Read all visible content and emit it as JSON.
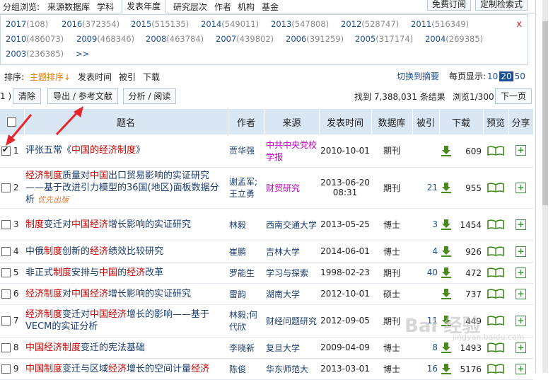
{
  "groupbar": {
    "label": "分组浏览:",
    "items": [
      "来源数据库",
      "学科",
      "发表年度",
      "研究层次",
      "作者",
      "机构",
      "基金"
    ],
    "buttons": [
      "免费订阅",
      "定制检索式"
    ]
  },
  "years": {
    "close": "x",
    "more": ">>",
    "items": [
      {
        "year": "2017",
        "count": "(108)"
      },
      {
        "year": "2016",
        "count": "(372354)"
      },
      {
        "year": "2015",
        "count": "(515135)"
      },
      {
        "year": "2014",
        "count": "(549011)"
      },
      {
        "year": "2013",
        "count": "(547808)"
      },
      {
        "year": "2012",
        "count": "(528747)"
      },
      {
        "year": "2011",
        "count": "(516349)"
      },
      {
        "year": "2010",
        "count": "(486073)"
      },
      {
        "year": "2009",
        "count": "(468346)"
      },
      {
        "year": "2008",
        "count": "(463784)"
      },
      {
        "year": "2007",
        "count": "(439802)"
      },
      {
        "year": "2006",
        "count": "(391259)"
      },
      {
        "year": "2005",
        "count": "(317174)"
      },
      {
        "year": "2004",
        "count": "(269385)"
      },
      {
        "year": "2003",
        "count": "(236385)"
      }
    ]
  },
  "sortbar": {
    "label": "排序:",
    "options": [
      "主题排序",
      "发表时间",
      "被引",
      "下载"
    ],
    "active_arrow": "↓",
    "switch_label": "切换到摘要",
    "page_size_label": "每页显示:",
    "page_sizes": [
      "10",
      "20",
      "50"
    ],
    "selected_page_size": "20"
  },
  "actions": {
    "count_prefix": "1 )",
    "clear": "清除",
    "export": "导出 / 参考文献",
    "analyze": "分析 / 阅读",
    "found": "找到 7,388,031 条结果",
    "browse": "浏览1/300",
    "next": "下一页"
  },
  "table": {
    "headers": [
      "题名",
      "作者",
      "来源",
      "发表时间",
      "数据库",
      "被引",
      "下载",
      "预览",
      "分享"
    ],
    "rows": [
      {
        "n": "1",
        "checked": true,
        "title": [
          [
            "评张五常《",
            0
          ],
          [
            "中国的经济制度",
            1
          ],
          [
            "》",
            0
          ]
        ],
        "sub": "",
        "author": "贾华强",
        "source": "中共中央党校学报",
        "source_mag": true,
        "date": "2010-10-01",
        "db": "期刊",
        "cite": "",
        "dl": "609"
      },
      {
        "n": "2",
        "checked": false,
        "title": [
          [
            "经济制度",
            1
          ],
          [
            "质量对",
            0
          ],
          [
            "中国",
            1
          ],
          [
            "出口贸易影响的实证研究——基于改进引力模型的36国(地区)面板数据分析",
            0
          ]
        ],
        "sub": "优先出版",
        "author": "谢孟军;王立勇",
        "source": "财贸研究",
        "source_mag": true,
        "date": "2013-06-20 08:31",
        "db": "期刊",
        "cite": "21",
        "dl": "955"
      },
      {
        "n": "3",
        "checked": false,
        "title": [
          [
            "制度",
            1
          ],
          [
            "变迁对",
            0
          ],
          [
            "中国经济",
            1
          ],
          [
            "增长影响的实证研究",
            0
          ]
        ],
        "sub": "",
        "author": "林毅",
        "source": "西南交通大学",
        "source_mag": false,
        "date": "2013-05-25",
        "db": "博士",
        "cite": "3",
        "dl": "1454"
      },
      {
        "n": "4",
        "checked": false,
        "title": [
          [
            "中俄",
            0
          ],
          [
            "制度",
            1
          ],
          [
            "创新的",
            0
          ],
          [
            "经济",
            1
          ],
          [
            "绩效比较研究",
            0
          ]
        ],
        "sub": "",
        "author": "崔鹏",
        "source": "吉林大学",
        "source_mag": false,
        "date": "2014-06-01",
        "db": "博士",
        "cite": "4",
        "dl": "926"
      },
      {
        "n": "5",
        "checked": false,
        "title": [
          [
            "非正式",
            0
          ],
          [
            "制度",
            1
          ],
          [
            "安排与",
            0
          ],
          [
            "中国",
            1
          ],
          [
            "的",
            0
          ],
          [
            "经济",
            1
          ],
          [
            "改革",
            0
          ]
        ],
        "sub": "",
        "author": "罗能生",
        "source": "学习与探索",
        "source_mag": false,
        "date": "1998-02-23",
        "db": "期刊",
        "cite": "40",
        "dl": "472"
      },
      {
        "n": "6",
        "checked": false,
        "title": [
          [
            "经济制度",
            1
          ],
          [
            "对",
            0
          ],
          [
            "中国经济",
            1
          ],
          [
            "增长影响的实证研究",
            0
          ]
        ],
        "sub": "",
        "author": "雷韵",
        "source": "湖南大学",
        "source_mag": false,
        "date": "2012-10-01",
        "db": "硕士",
        "cite": "",
        "dl": "737"
      },
      {
        "n": "7",
        "checked": false,
        "title": [
          [
            "经济制度",
            1
          ],
          [
            "变迁对",
            0
          ],
          [
            "中国经济",
            1
          ],
          [
            "增长的影响——基于VECM的实证分析",
            0
          ]
        ],
        "sub": "",
        "author": "林毅;何代欣",
        "source": "财经问题研究",
        "source_mag": false,
        "date": "2012-09-05",
        "db": "期刊",
        "cite": "11",
        "dl": "449"
      },
      {
        "n": "8",
        "checked": false,
        "title": [
          [
            "中国经济制度",
            1
          ],
          [
            "变迁的宪法基础",
            0
          ]
        ],
        "sub": "",
        "author": "李晓新",
        "source": "复旦大学",
        "source_mag": false,
        "date": "2009-04-09",
        "db": "博士",
        "cite": "8",
        "dl": "1493"
      },
      {
        "n": "9",
        "checked": false,
        "title": [
          [
            "中国制度",
            1
          ],
          [
            "变迁与区域",
            0
          ],
          [
            "经济",
            1
          ],
          [
            "增长的空间计量",
            0
          ],
          [
            "经济",
            1
          ]
        ],
        "sub": "",
        "author": "陈俊",
        "source": "华东师范大",
        "source_mag": false,
        "date": "2013-03-01",
        "db": "博士",
        "cite": "16",
        "dl": "5176"
      }
    ]
  },
  "watermark": {
    "main": "Bai 经验",
    "sub": "jingyan.baidu.com"
  },
  "colors": {
    "header_bg": "#d9e6f4",
    "link": "#1a4e96",
    "highlight": "#c40000",
    "arrow": "#e8242b",
    "download": "#4a8a1c",
    "add": "#3a9a3a"
  }
}
